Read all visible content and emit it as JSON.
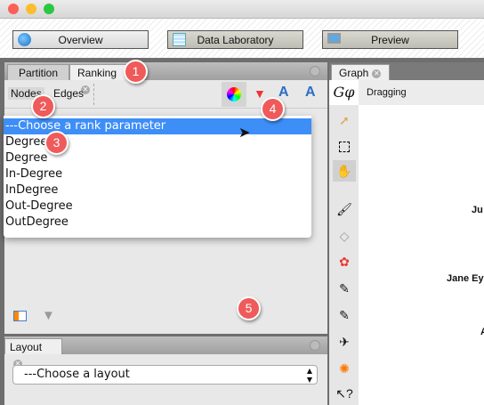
{
  "workspace_buttons": {
    "overview": "Overview",
    "data_laboratory": "Data Laboratory",
    "preview": "Preview"
  },
  "ranking_panel": {
    "tabs": {
      "partition": "Partition",
      "ranking": "Ranking"
    },
    "subtabs": {
      "nodes": "Nodes",
      "edges": "Edges"
    },
    "dropdown": {
      "selected": "---Choose a rank parameter",
      "options": [
        "Degree",
        "Degree",
        "In-Degree",
        "InDegree",
        "Out-Degree",
        "OutDegree"
      ]
    }
  },
  "layout_panel": {
    "tab": "Layout",
    "select_value": "---Choose a layout"
  },
  "graph_panel": {
    "tab": "Graph",
    "mode": "Dragging",
    "node_labels": [
      "Ju",
      "Jane Ey",
      "A"
    ]
  },
  "badges": [
    "1",
    "2",
    "3",
    "4",
    "5"
  ],
  "colors": {
    "highlight": "#3e8ef7",
    "badge": "#ef5a5a"
  }
}
